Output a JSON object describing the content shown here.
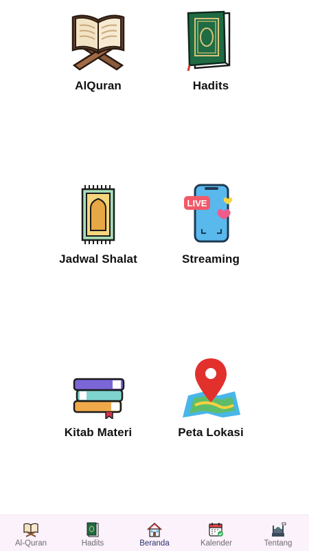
{
  "menu": {
    "items": [
      {
        "label": "AlQuran",
        "icon": "open-quran-on-stand-icon"
      },
      {
        "label": "Hadits",
        "icon": "green-book-icon"
      },
      {
        "label": "Jadwal Shalat",
        "icon": "prayer-mat-icon"
      },
      {
        "label": "Streaming",
        "icon": "live-phone-icon"
      },
      {
        "label": "Kitab Materi",
        "icon": "stacked-books-icon"
      },
      {
        "label": "Peta Lokasi",
        "icon": "map-pin-icon"
      }
    ]
  },
  "bottom_nav": {
    "active": "Beranda",
    "items": [
      {
        "label": "Al-Quran",
        "icon": "quran-icon"
      },
      {
        "label": "Hadits",
        "icon": "book-icon"
      },
      {
        "label": "Beranda",
        "icon": "home-icon"
      },
      {
        "label": "Kalender",
        "icon": "calendar-icon"
      },
      {
        "label": "Tentang",
        "icon": "mosque-icon"
      }
    ]
  },
  "colors": {
    "nav_bg": "#fbf2fb",
    "active_label": "#2b2f6b",
    "inactive_label": "#6f6a70"
  }
}
